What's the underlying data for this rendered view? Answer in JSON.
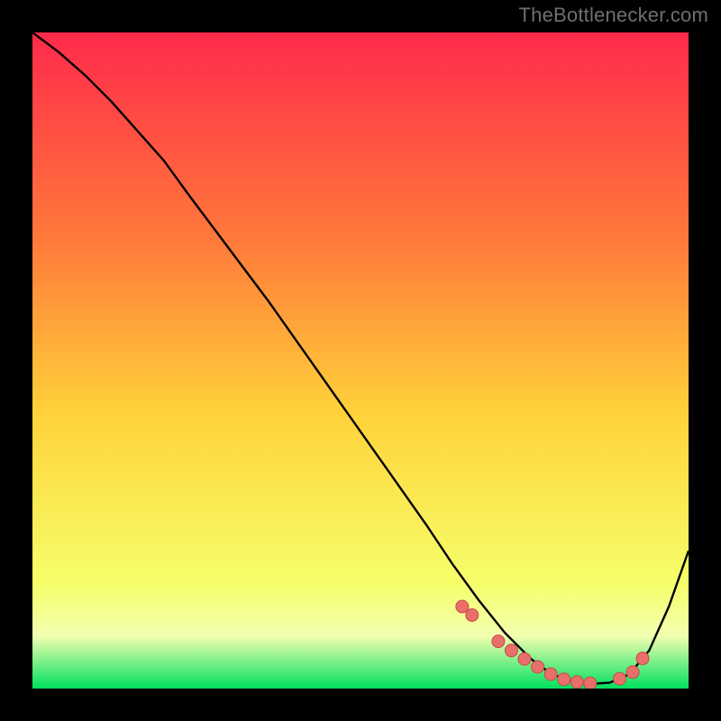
{
  "attribution": "TheBottlenecker.com",
  "colors": {
    "frame": "#000000",
    "grad_top": "#ff2a4b",
    "grad_mid1": "#ff7a3a",
    "grad_mid2": "#ffd23a",
    "grad_low": "#f6ff6a",
    "grad_band_light": "#f2ffb0",
    "grad_bottom": "#00e060",
    "curve": "#000000",
    "marker_fill": "#e96f6b",
    "marker_stroke": "#c74b46"
  },
  "chart_data": {
    "type": "line",
    "title": "",
    "xlabel": "",
    "ylabel": "",
    "xlim": [
      0,
      100
    ],
    "ylim": [
      0,
      100
    ],
    "series": [
      {
        "name": "bottleneck-curve",
        "x": [
          0,
          4,
          8,
          12,
          16,
          20,
          24,
          30,
          36,
          42,
          48,
          54,
          60,
          64,
          68,
          72,
          76,
          79,
          82,
          85,
          88,
          91,
          94,
          97,
          100
        ],
        "y": [
          100,
          97,
          93.5,
          89.5,
          85,
          80.5,
          75,
          67,
          59,
          50.5,
          42,
          33.5,
          25,
          19,
          13.5,
          8.5,
          4.5,
          2.3,
          1.1,
          0.7,
          0.9,
          2.2,
          5.8,
          12.5,
          21
        ]
      }
    ],
    "markers": {
      "name": "highlight-dots",
      "x": [
        65.5,
        67,
        71,
        73,
        75,
        77,
        79,
        81,
        83,
        85,
        89.5,
        91.5,
        93
      ],
      "y": [
        12.5,
        11.2,
        7.2,
        5.8,
        4.5,
        3.3,
        2.2,
        1.4,
        1.0,
        0.8,
        1.5,
        2.5,
        4.6
      ]
    }
  }
}
